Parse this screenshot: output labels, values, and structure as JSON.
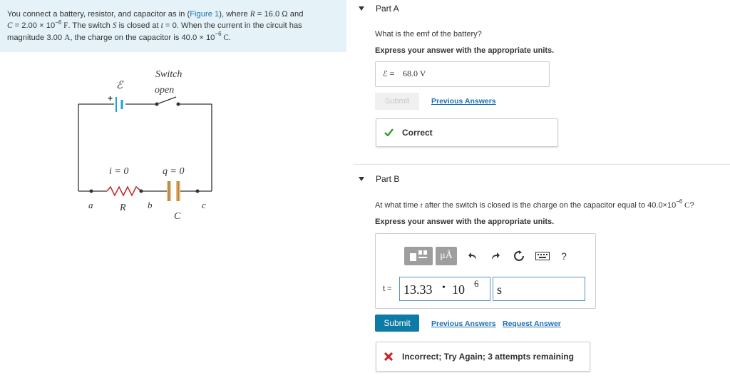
{
  "problem": {
    "text_1": "You connect a battery, resistor, and capacitor as in (",
    "figure_link": "Figure 1",
    "text_2": "), where ",
    "R_sym": "R",
    "R_val": " = 16.0 Ω and",
    "C_sym": "C",
    "C_val": " = 2.00 × 10",
    "C_exp": "−6",
    "C_unit": " F",
    "text_3": ". The switch ",
    "S_sym": "S",
    "text_4": " is closed at ",
    "t_sym": "t",
    "text_5": " = 0. When the current in the circuit has",
    "text_6": "magnitude 3.00 ",
    "A_unit": "A",
    "text_7": ", the charge on the capacitor is 40.0 × 10",
    "q_exp": "−6",
    "q_unit": " C",
    "text_8": "."
  },
  "figure": {
    "emf": "ℰ",
    "switch": "Switch",
    "open": "open",
    "plus": "+",
    "i": "i = 0",
    "q": "q = 0",
    "a": "a",
    "R": "R",
    "b": "b",
    "C": "C",
    "c": "c"
  },
  "partA": {
    "title": "Part A",
    "question": "What is the emf of the battery?",
    "instruction": "Express your answer with the appropriate units.",
    "answer_label": "ℰ =",
    "answer_value": "68.0 V",
    "submit": "Submit",
    "previous_answers": "Previous Answers",
    "feedback": "Correct"
  },
  "partB": {
    "title": "Part B",
    "question_1": "At what time ",
    "t_sym": "t",
    "question_2": " after the switch is closed is the charge on the capacitor equal to 40.0×10",
    "q_exp": "−6",
    "q_unit": " C",
    "question_3": "?",
    "instruction": "Express your answer with the appropriate units.",
    "toolbar": {
      "templates": "templates-icon",
      "units": "μÅ",
      "undo": "undo-icon",
      "redo": "redo-icon",
      "reset": "reset-icon",
      "keyboard": "keyboard-icon",
      "help": "?"
    },
    "answer_label": "t =",
    "value_mantissa": "13.33",
    "value_dot": "•",
    "value_base": "10",
    "value_exp": "6",
    "units_value": "s",
    "submit": "Submit",
    "previous_answers": "Previous Answers",
    "request_answer": "Request Answer",
    "feedback": "Incorrect; Try Again; 3 attempts remaining"
  },
  "colors": {
    "submit": "#0e7aa6",
    "link": "#1a6fb0",
    "correct": "#3c9a3c",
    "incorrect": "#c0262b",
    "problem_bg": "#e5f3f8",
    "battery": "#1aa0dd",
    "resistor": "#c0262b",
    "capacitor": "#f0b86a"
  }
}
